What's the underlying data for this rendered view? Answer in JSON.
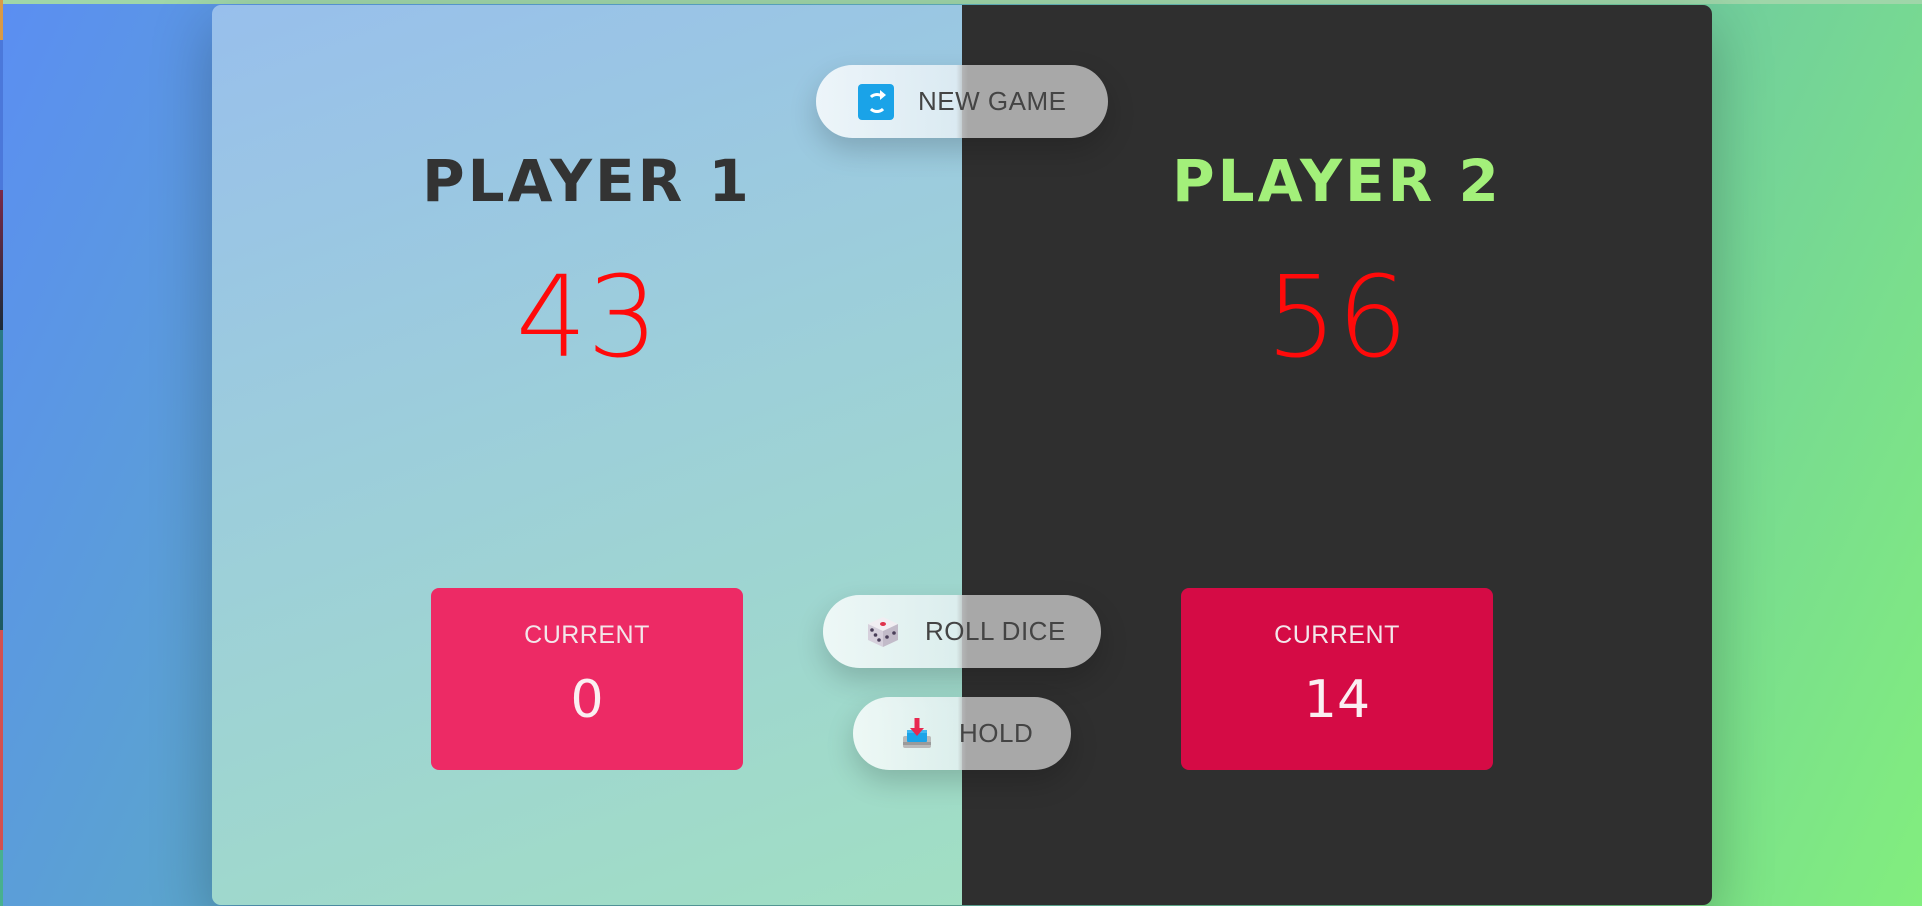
{
  "players": [
    {
      "name": "PLAYER 1",
      "score": "43",
      "current_label": "CURRENT",
      "current_score": "0",
      "active": false
    },
    {
      "name": "PLAYER 2",
      "score": "56",
      "current_label": "CURRENT",
      "current_score": "14",
      "active": true
    }
  ],
  "buttons": {
    "new_game": {
      "label": "NEW GAME",
      "icon": "refresh-icon"
    },
    "roll_dice": {
      "label": "ROLL DICE",
      "icon": "dice-icon"
    },
    "hold": {
      "label": "HOLD",
      "icon": "inbox-tray-icon"
    }
  },
  "colors": {
    "score_red": "#ff0a0a",
    "active_name_green": "#a3f07a",
    "current_box_player1": "#ed2a65",
    "current_box_player2": "#d50b45",
    "player2_panel": "#2f2f2f"
  }
}
